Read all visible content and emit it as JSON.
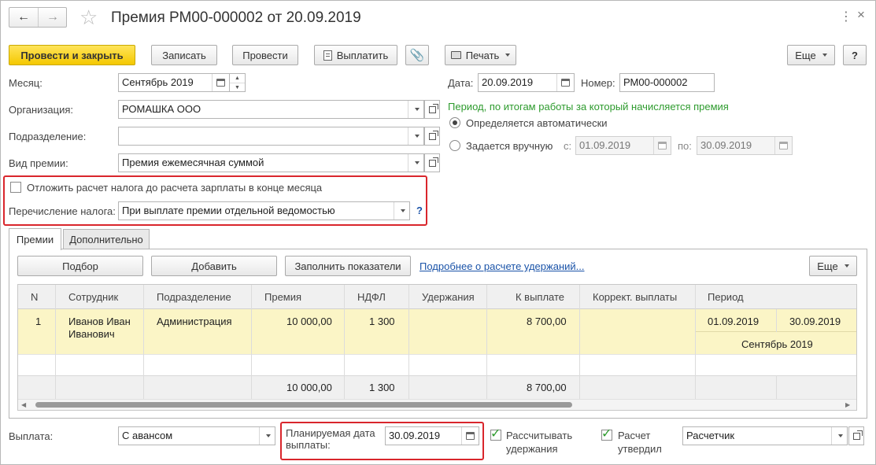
{
  "window": {
    "title": "Премия РМ00-000002 от 20.09.2019"
  },
  "toolbar": {
    "post_close": "Провести и закрыть",
    "save": "Записать",
    "post": "Провести",
    "pay": "Выплатить",
    "print": "Печать",
    "more": "Еще",
    "help": "?"
  },
  "form": {
    "month_label": "Месяц:",
    "month_value": "Сентябрь 2019",
    "org_label": "Организация:",
    "org_value": "РОМАШКА ООО",
    "dept_label": "Подразделение:",
    "dept_value": "",
    "bonus_type_label": "Вид премии:",
    "bonus_type_value": "Премия ежемесячная суммой",
    "defer_tax_label": "Отложить расчет налога до расчета зарплаты в конце месяца",
    "tax_transfer_label": "Перечисление налога:",
    "tax_transfer_value": "При выплате премии отдельной ведомостью",
    "tax_help": "?",
    "date_label": "Дата:",
    "date_value": "20.09.2019",
    "number_label": "Номер:",
    "number_value": "РМ00-000002",
    "period_title": "Период, по итогам работы за который начисляется премия",
    "period_auto": "Определяется автоматически",
    "period_manual": "Задается вручную",
    "from_label": "с:",
    "from_value": "01.09.2019",
    "to_label": "по:",
    "to_value": "30.09.2019"
  },
  "tabs": [
    "Премии",
    "Дополнительно"
  ],
  "table_toolbar": {
    "pick": "Подбор",
    "add": "Добавить",
    "fill": "Заполнить показатели",
    "details_link": "Подробнее о расчете удержаний...",
    "more": "Еще"
  },
  "table": {
    "columns": [
      "N",
      "Сотрудник",
      "Подразделение",
      "Премия",
      "НДФЛ",
      "Удержания",
      "К выплате",
      "Коррект. выплаты",
      "Период"
    ],
    "rows": [
      {
        "n": "1",
        "employee_line1": "Иванов Иван",
        "employee_line2": "Иванович",
        "department": "Администрация",
        "bonus": "10 000,00",
        "ndfl": "1 300",
        "deductions": "",
        "to_pay": "8 700,00",
        "correction": "",
        "period_from": "01.09.2019",
        "period_to": "30.09.2019",
        "period_month": "Сентябрь 2019"
      }
    ],
    "totals": {
      "bonus": "10 000,00",
      "ndfl": "1 300",
      "to_pay": "8 700,00"
    }
  },
  "footer": {
    "payment_label": "Выплата:",
    "payment_value": "С авансом",
    "planned_date_label_1": "Планируемая дата",
    "planned_date_label_2": "выплаты:",
    "planned_date_value": "30.09.2019",
    "calc_deductions_1": "Рассчитывать",
    "calc_deductions_2": "удержания",
    "calc_approved_1": "Расчет",
    "calc_approved_2": "утвердил",
    "approver_value": "Расчетчик"
  },
  "colors": {
    "primary_button": "#f4c800",
    "highlight_red": "#d9262c",
    "row_selected": "#fbf5c6",
    "green_text": "#2e9b2e",
    "link": "#1a53a8"
  }
}
